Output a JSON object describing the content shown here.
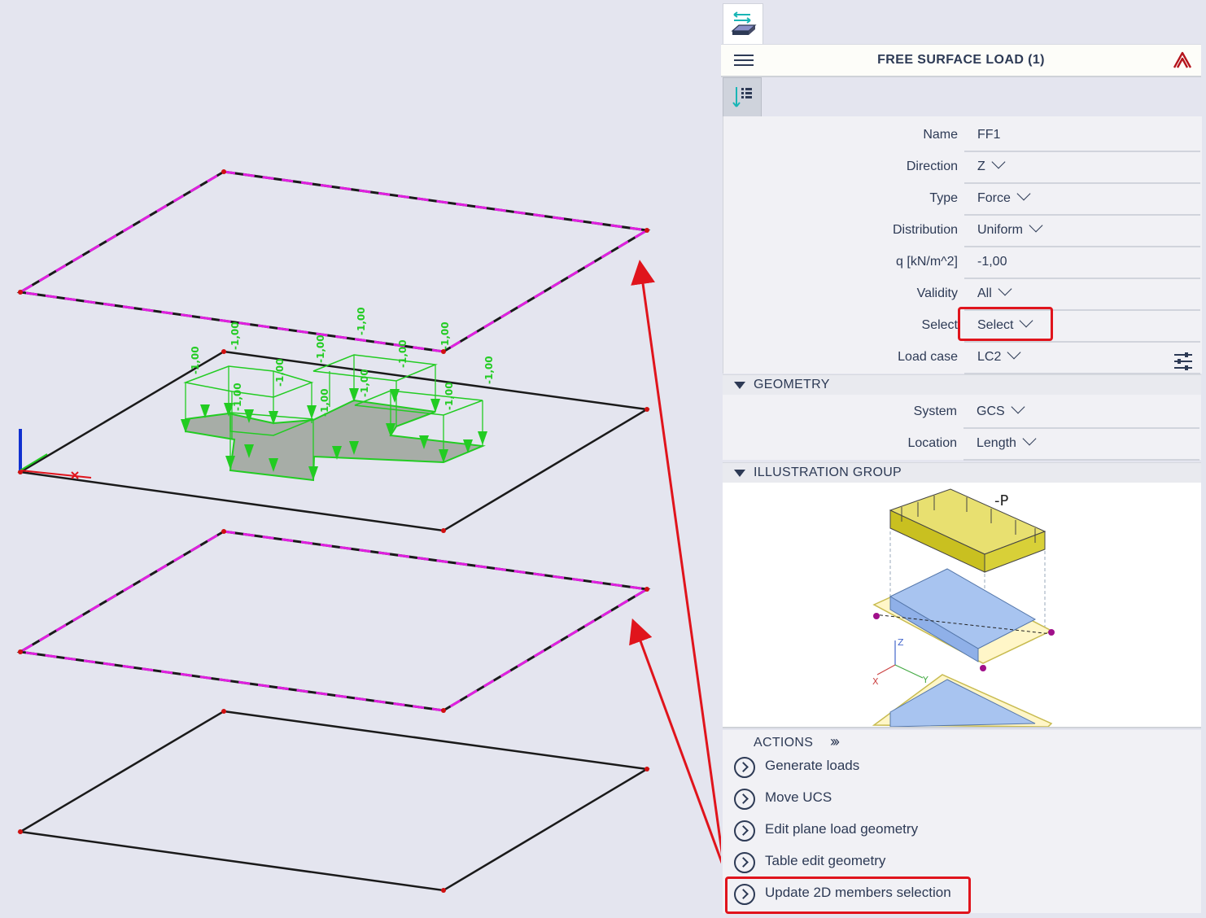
{
  "panel": {
    "title": "FREE SURFACE LOAD (1)",
    "properties": [
      {
        "key": "Name",
        "value": "FF1",
        "dropdown": false
      },
      {
        "key": "Direction",
        "value": "Z",
        "dropdown": true
      },
      {
        "key": "Type",
        "value": "Force",
        "dropdown": true
      },
      {
        "key": "Distribution",
        "value": "Uniform",
        "dropdown": true
      },
      {
        "key": "q [kN/m^2]",
        "value": "-1,00",
        "dropdown": false
      },
      {
        "key": "Validity",
        "value": "All",
        "dropdown": true
      },
      {
        "key": "Select",
        "value": "Select",
        "dropdown": true
      },
      {
        "key": "Load case",
        "value": "LC2",
        "dropdown": true
      }
    ],
    "geometry_section": "GEOMETRY",
    "geometry": [
      {
        "key": "System",
        "value": "GCS"
      },
      {
        "key": "Location",
        "value": "Length"
      }
    ],
    "illustration_section": "ILLUSTRATION GROUP",
    "illustration_label": "-P",
    "illustration_axes": {
      "z": "Z",
      "x": "X",
      "y": "Y"
    },
    "actions_label": "ACTIONS",
    "actions": [
      "Generate loads",
      "Move UCS",
      "Edit plane load geometry",
      "Table edit geometry",
      "Update 2D members selection"
    ]
  },
  "viewport": {
    "load_value_label": "-1,00"
  },
  "colors": {
    "highlight": "#e0141c",
    "load": "#22cc22",
    "selected_edge": "#e020e0",
    "edge": "#1a1a1a"
  }
}
